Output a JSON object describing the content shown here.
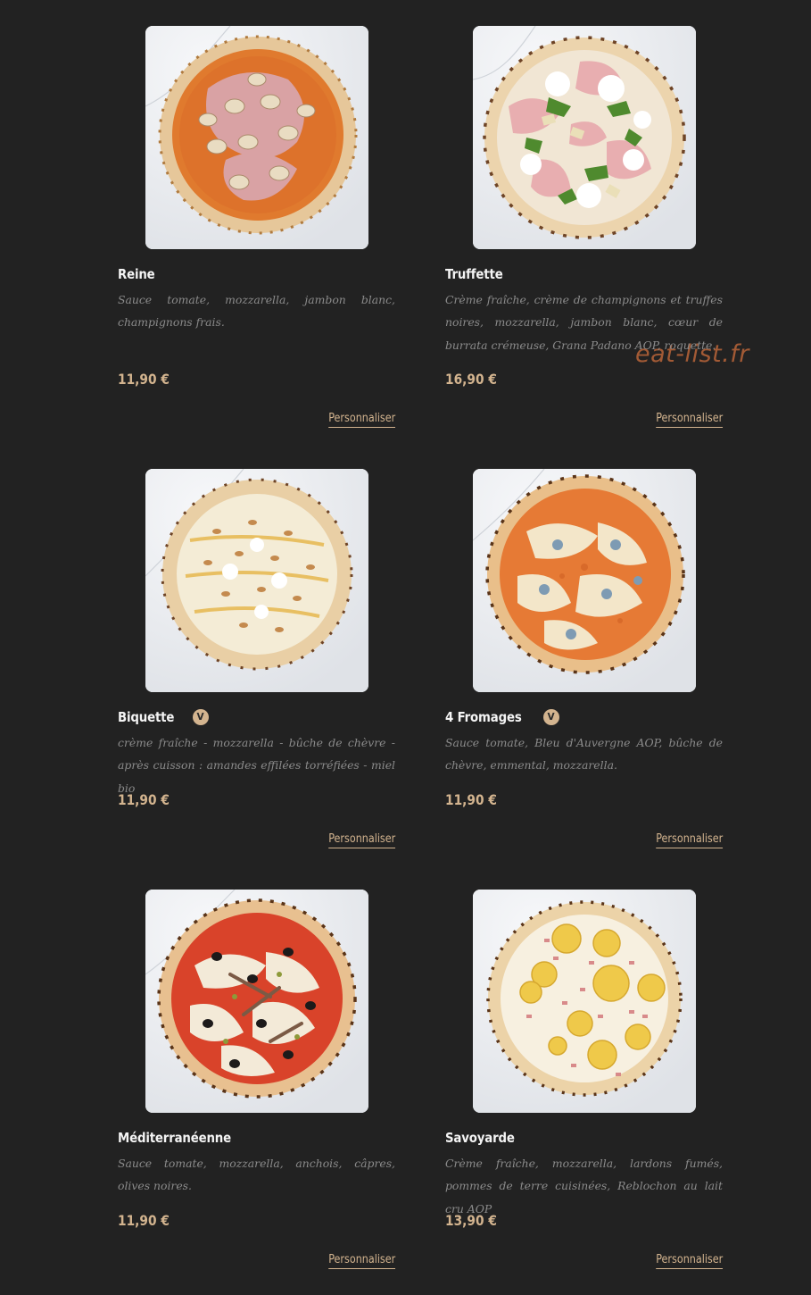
{
  "watermark": "eat-list.fr",
  "accent_color": "#d3b48f",
  "background_color": "#222222",
  "items": [
    {
      "name": "Reine",
      "badge": "",
      "description": "Sauce tomate, mozzarella, jambon blanc, champignons frais.",
      "price": "11,90 €",
      "action": "Personnaliser",
      "image": "reine-pizza-photo"
    },
    {
      "name": "Truffette",
      "badge": "",
      "description": "Crème fraîche, crème de champignons et truffes noires, mozzarella, jambon blanc, cœur de burrata crémeuse, Grana Padano AOP, roquette.",
      "price": "16,90 €",
      "action": "Personnaliser",
      "image": "truffette-pizza-photo"
    },
    {
      "name": "Biquette",
      "badge": "V",
      "description": "crème fraîche - mozzarella - bûche de chèvre - après cuisson : amandes effilées torréfiées - miel bio",
      "price": "11,90 €",
      "action": "Personnaliser",
      "image": "biquette-pizza-photo"
    },
    {
      "name": "4 Fromages",
      "badge": "V",
      "description": "Sauce tomate, Bleu d'Auvergne AOP, bûche de chèvre, emmental, mozzarella.",
      "price": "11,90 €",
      "action": "Personnaliser",
      "image": "4-fromages-pizza-photo"
    },
    {
      "name": "Méditerranéenne",
      "badge": "",
      "description": "Sauce tomate, mozzarella, anchois, câpres, olives noires.",
      "price": "11,90 €",
      "action": "Personnaliser",
      "image": "mediterraneenne-pizza-photo"
    },
    {
      "name": "Savoyarde",
      "badge": "",
      "description": "Crème fraîche, mozzarella, lardons fumés, pommes de terre cuisinées, Reblochon au lait cru AOP",
      "price": "13,90 €",
      "action": "Personnaliser",
      "image": "savoyarde-pizza-photo"
    }
  ]
}
